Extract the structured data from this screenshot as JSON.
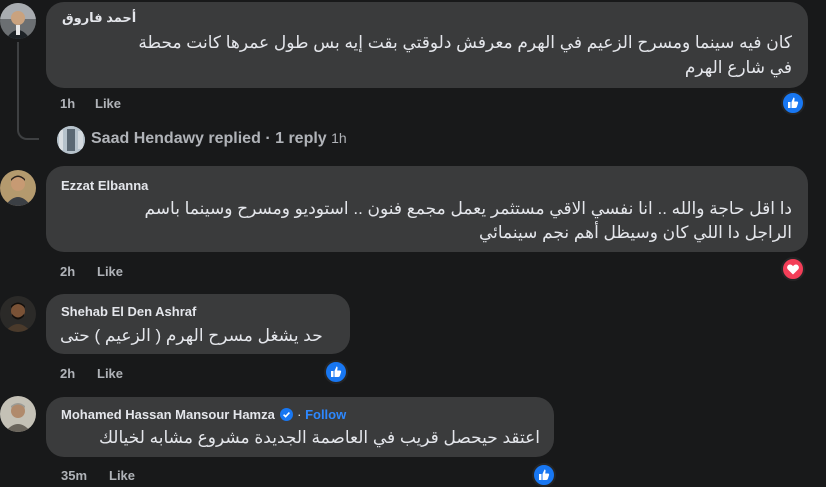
{
  "colors": {
    "background": "#18191a",
    "bubble": "#3a3b3c",
    "text": "#e4e6eb",
    "meta": "#b0b3b8",
    "link": "#2d88ff",
    "like": "#1877f2",
    "love": "#f33e58"
  },
  "comments": [
    {
      "author": "أحمد فاروق",
      "lines": [
        "كان فيه سينما ومسرح الزعيم في الهرم معرفش دلوقتي بقت إيه بس طول عمرها كانت محطة",
        "في شارع الهرم"
      ],
      "time": "1h",
      "like_label": "Like",
      "reaction_icon": "like-icon"
    },
    {
      "author": "Ezzat Elbanna",
      "lines": [
        "دا اقل حاجة والله .. انا نفسي الاقي مستثمر يعمل مجمع فنون .. استوديو ومسرح وسينما باسم",
        "الراجل دا اللي كان وسيظل أهم نجم سينمائي"
      ],
      "time": "2h",
      "like_label": "Like",
      "reaction_icon": "love-icon"
    },
    {
      "author": "Shehab El Den Ashraf",
      "lines": [
        "حد يشغل مسرح الهرم ( الزعيم ) حتى"
      ],
      "time": "2h",
      "like_label": "Like",
      "reaction_icon": "like-icon"
    },
    {
      "author": "Mohamed Hassan Mansour Hamza",
      "verified_icon": "verified-badge-icon",
      "separator": "·",
      "follow_label": "Follow",
      "lines": [
        "اعتقد حيحصل قريب في العاصمة الجديدة مشروع مشابه لخيالك"
      ],
      "time": "35m",
      "like_label": "Like",
      "reaction_icon": "like-icon"
    }
  ],
  "reply_summary": {
    "author": "Saad Hendawy",
    "action": "replied",
    "separator": "·",
    "count": "1 reply",
    "time": "1h"
  }
}
